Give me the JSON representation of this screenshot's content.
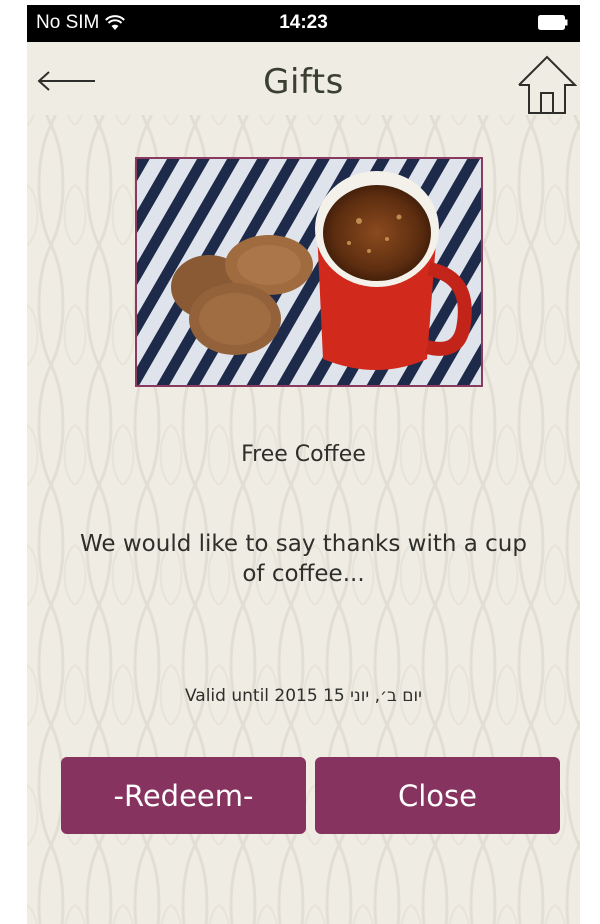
{
  "status_bar": {
    "carrier": "No SIM",
    "time": "14:23"
  },
  "header": {
    "title": "Gifts",
    "back_icon": "arrow-left-icon",
    "home_icon": "home-icon"
  },
  "gift": {
    "title": "Free Coffee",
    "description": "We would like to say thanks with a cup of coffee...",
    "validity": "Valid until 2015 15 יום ב׳, יוני"
  },
  "actions": {
    "redeem_label": "-Redeem-",
    "close_label": "Close"
  },
  "colors": {
    "accent": "#86335f",
    "background": "#efece4",
    "text": "#2e2e2a"
  }
}
